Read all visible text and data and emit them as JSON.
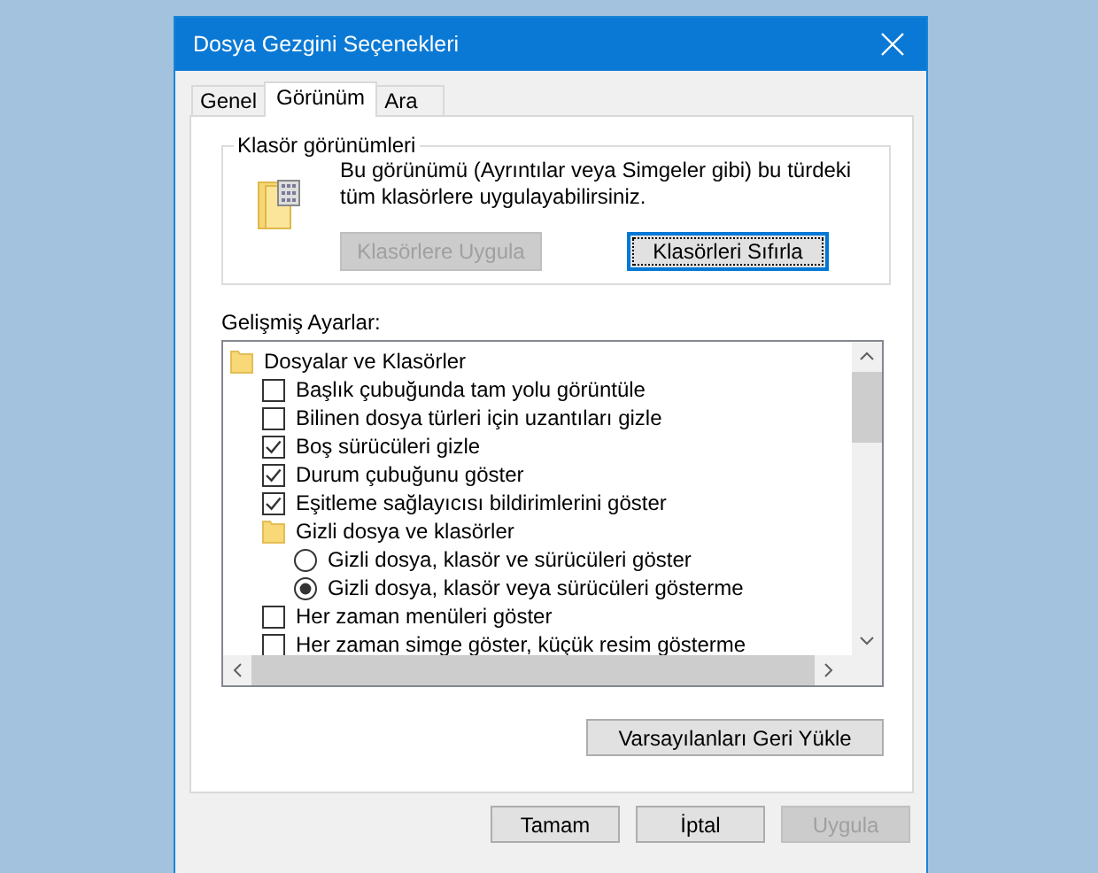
{
  "window": {
    "title": "Dosya Gezgini Seçenekleri"
  },
  "tabs": [
    {
      "label": "Genel",
      "selected": false
    },
    {
      "label": "Görünüm",
      "selected": true
    },
    {
      "label": "Ara",
      "selected": false
    }
  ],
  "folder_views": {
    "title": "Klasör görünümleri",
    "description": "Bu görünümü (Ayrıntılar veya Simgeler gibi) bu türdeki tüm klasörlere uygulayabilirsiniz.",
    "buttons": [
      {
        "label": "Klasörlere Uygula",
        "disabled": true,
        "focused": false
      },
      {
        "label": "Klasörleri Sıfırla",
        "disabled": false,
        "focused": true
      }
    ]
  },
  "advanced": {
    "label": "Gelişmiş Ayarlar:",
    "items": [
      {
        "kind": "folder",
        "label": "Dosyalar ve Klasörler",
        "children": [
          {
            "kind": "checkbox",
            "label": "Başlık çubuğunda tam yolu görüntüle",
            "checked": false
          },
          {
            "kind": "checkbox",
            "label": "Bilinen dosya türleri için uzantıları gizle",
            "checked": false
          },
          {
            "kind": "checkbox",
            "label": "Boş sürücüleri gizle",
            "checked": true
          },
          {
            "kind": "checkbox",
            "label": "Durum çubuğunu göster",
            "checked": true
          },
          {
            "kind": "checkbox",
            "label": "Eşitleme sağlayıcısı bildirimlerini göster",
            "checked": true
          },
          {
            "kind": "folder",
            "label": "Gizli dosya ve klasörler",
            "children": [
              {
                "kind": "radio",
                "label": "Gizli dosya, klasör ve sürücüleri göster",
                "selected": false
              },
              {
                "kind": "radio",
                "label": "Gizli dosya, klasör veya sürücüleri gösterme",
                "selected": true
              }
            ]
          },
          {
            "kind": "checkbox",
            "label": "Her zaman menüleri göster",
            "checked": false
          },
          {
            "kind": "checkbox",
            "label": "Her zaman simge göster, küçük resim gösterme",
            "checked": false
          }
        ]
      }
    ],
    "restore_button": {
      "label": "Varsayılanları Geri Yükle",
      "disabled": false
    }
  },
  "buttons": [
    {
      "label": "Tamam",
      "disabled": false
    },
    {
      "label": "İptal",
      "disabled": false
    },
    {
      "label": "Uygula",
      "disabled": true
    }
  ]
}
